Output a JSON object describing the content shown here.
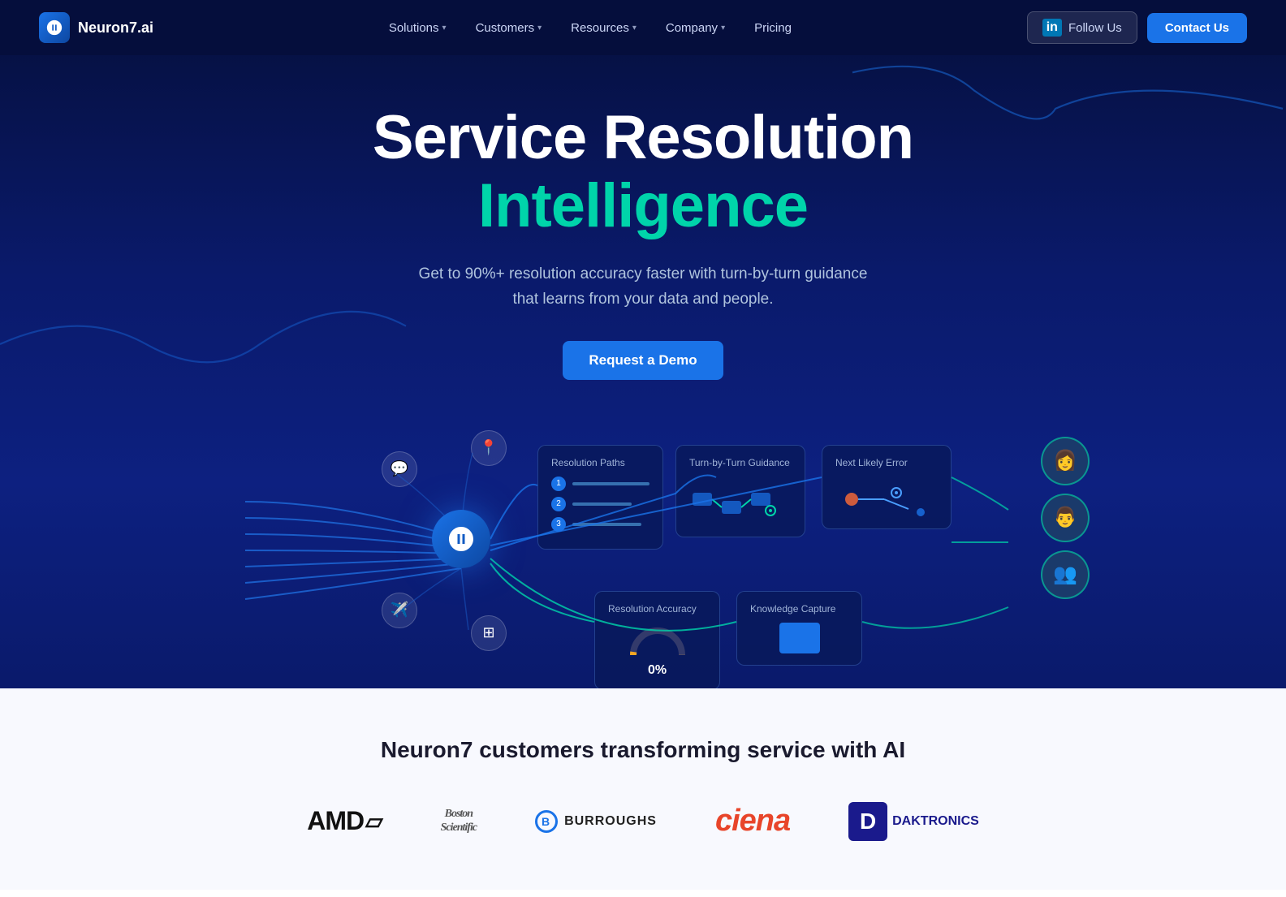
{
  "navbar": {
    "logo_text": "Neuron7.ai",
    "nav_items": [
      {
        "label": "Solutions",
        "has_dropdown": true
      },
      {
        "label": "Customers",
        "has_dropdown": true
      },
      {
        "label": "Resources",
        "has_dropdown": true
      },
      {
        "label": "Company",
        "has_dropdown": true
      },
      {
        "label": "Pricing",
        "has_dropdown": false
      }
    ],
    "follow_label": "Follow Us",
    "contact_label": "Contact Us"
  },
  "hero": {
    "title_line1": "Service Resolution",
    "title_line2": "Intelligence",
    "subtitle": "Get to 90%+ resolution accuracy faster with turn-by-turn guidance that learns from your data and people.",
    "cta_label": "Request a Demo"
  },
  "diagram": {
    "cards": {
      "resolution_paths": {
        "title": "Resolution Paths",
        "items": [
          {
            "num": "1",
            "bar_width": "80%"
          },
          {
            "num": "2",
            "bar_width": "60%"
          },
          {
            "num": "3",
            "bar_width": "70%"
          }
        ]
      },
      "guidance": {
        "title": "Turn-by-Turn Guidance"
      },
      "next_error": {
        "title": "Next Likely Error"
      },
      "accuracy": {
        "title": "Resolution Accuracy",
        "value": "0%"
      },
      "knowledge": {
        "title": "Knowledge Capture"
      }
    }
  },
  "customers": {
    "title": "Neuron7 customers transforming service with AI",
    "logos": [
      {
        "name": "AMD",
        "type": "amd"
      },
      {
        "name": "Boston Scientific",
        "type": "boston"
      },
      {
        "name": "Burroughs",
        "type": "burroughs"
      },
      {
        "name": "Ciena",
        "type": "ciena"
      },
      {
        "name": "Daktronics",
        "type": "daktronics"
      }
    ]
  }
}
